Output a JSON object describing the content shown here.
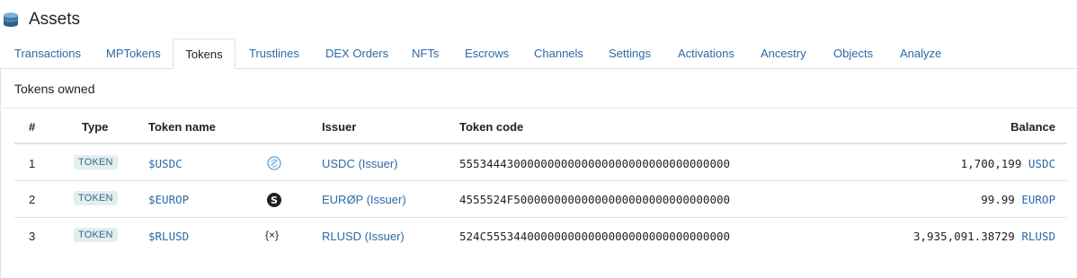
{
  "header": {
    "title": "Assets",
    "logo_icon": "coin-stack-icon"
  },
  "tabs": [
    {
      "label": "Transactions",
      "active": false
    },
    {
      "label": "MPTokens",
      "active": false
    },
    {
      "label": "Tokens",
      "active": true
    },
    {
      "label": "Trustlines",
      "active": false
    },
    {
      "label": "DEX Orders",
      "active": false
    },
    {
      "label": "NFTs",
      "active": false
    },
    {
      "label": "Escrows",
      "active": false
    },
    {
      "label": "Channels",
      "active": false
    },
    {
      "label": "Settings",
      "active": false
    },
    {
      "label": "Activations",
      "active": false
    },
    {
      "label": "Ancestry",
      "active": false
    },
    {
      "label": "Objects",
      "active": false
    },
    {
      "label": "Analyze",
      "active": false
    }
  ],
  "panel": {
    "title": "Tokens owned"
  },
  "table": {
    "headers": {
      "index": "#",
      "type": "Type",
      "name": "Token name",
      "issuer": "Issuer",
      "code": "Token code",
      "balance": "Balance"
    },
    "rows": [
      {
        "index": "1",
        "type": "TOKEN",
        "name": "$USDC",
        "icon": "usdc-logo-icon",
        "issuer": "USDC (Issuer)",
        "code": "5553444300000000000000000000000000000000",
        "amount": "1,700,199",
        "currency": "USDC"
      },
      {
        "index": "2",
        "type": "TOKEN",
        "name": "$EUROP",
        "icon": "europ-logo-icon",
        "issuer": "EURØP (Issuer)",
        "code": "4555524F50000000000000000000000000000000",
        "amount": "99.99",
        "currency": "EUROP"
      },
      {
        "index": "3",
        "type": "TOKEN",
        "name": "$RLUSD",
        "icon": "rlusd-logo-icon",
        "issuer": "RLUSD (Issuer)",
        "code": "524C555344000000000000000000000000000000",
        "amount": "3,935,091.38729",
        "currency": "RLUSD"
      }
    ]
  },
  "colors": {
    "link": "#2b6aa6",
    "badge_bg": "#e3eef1",
    "badge_text": "#2b6f7f",
    "border": "#dee2e6",
    "usdc_logo": "#5ea0d8"
  }
}
